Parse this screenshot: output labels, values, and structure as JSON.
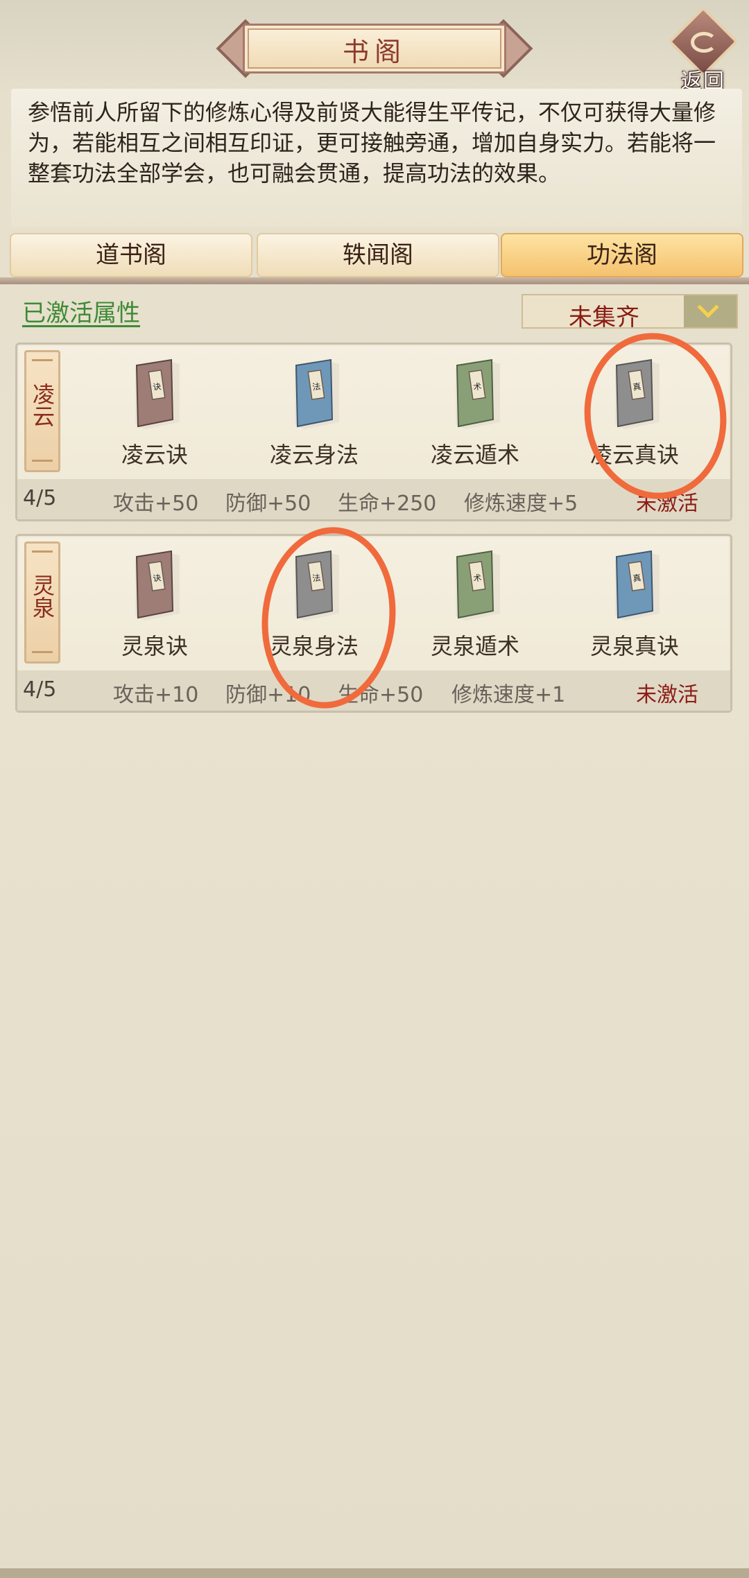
{
  "header": {
    "title": "书阁",
    "back_label": "返回"
  },
  "intro": {
    "text": "参悟前人所留下的修炼心得及前贤大能得生平传记，不仅可获得大量修为，若能相互之间相互印证，更可接触旁通，增加自身实力。若能将一整套功法全部学会，也可融会贯通，提高功法的效果。"
  },
  "tabs": [
    {
      "label": "道书阁",
      "selected": false
    },
    {
      "label": "轶闻阁",
      "selected": false
    },
    {
      "label": "功法阁",
      "selected": true
    }
  ],
  "filter": {
    "activated_link": "已激活属性",
    "dropdown_value": "未集齐"
  },
  "sets": [
    {
      "name": "凌云",
      "books": [
        {
          "label": "凌云诀",
          "color": "#9d7d76",
          "collected": true
        },
        {
          "label": "凌云身法",
          "color": "#6f98b8",
          "collected": true
        },
        {
          "label": "凌云遁术",
          "color": "#89a077",
          "collected": true
        },
        {
          "label": "凌云真诀",
          "color": "#8e8e8e",
          "collected": false
        }
      ],
      "count": "4/5",
      "stats": [
        "攻击+50",
        "防御+50",
        "生命+250",
        "修炼速度+5"
      ],
      "status": "未激活"
    },
    {
      "name": "灵泉",
      "books": [
        {
          "label": "灵泉诀",
          "color": "#9d7d76",
          "collected": true
        },
        {
          "label": "灵泉身法",
          "color": "#8e8e8e",
          "collected": false
        },
        {
          "label": "灵泉遁术",
          "color": "#89a077",
          "collected": true
        },
        {
          "label": "灵泉真诀",
          "color": "#6f98b8",
          "collected": true
        }
      ],
      "count": "4/5",
      "stats": [
        "攻击+10",
        "防御+10",
        "生命+50",
        "修炼速度+1"
      ],
      "status": "未激活"
    }
  ],
  "colors": {
    "accent_red": "#8c1c16",
    "link_green": "#3e8a35",
    "annotation_orange": "#f06a3c"
  }
}
